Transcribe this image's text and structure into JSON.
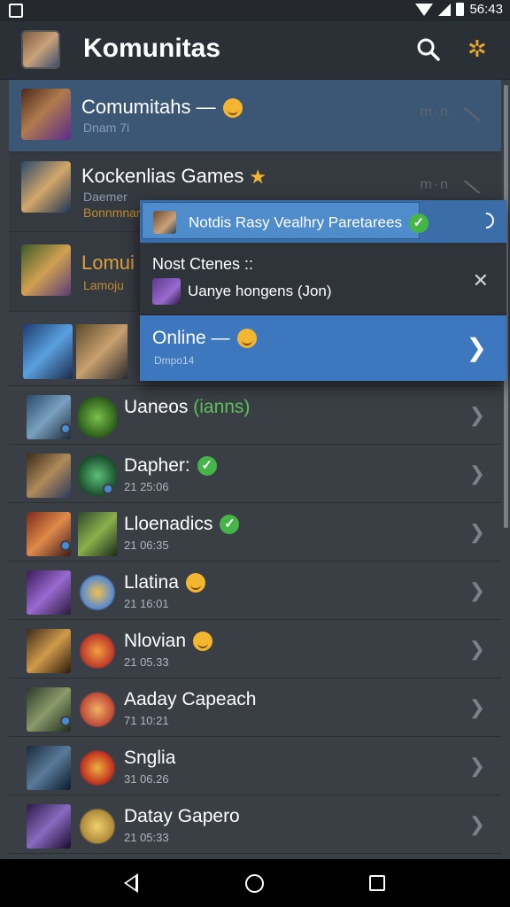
{
  "status_bar": {
    "time": "56:43"
  },
  "app_bar": {
    "title": "Komunitas"
  },
  "top_list": [
    {
      "name": "Comumitahs —",
      "sub": "Dnam 7i",
      "mute": "m·n"
    },
    {
      "name": "Kockenlias Games",
      "sub": "Daemer",
      "sub2": "Bonnmnar",
      "mute": "m·n"
    },
    {
      "name": "Lomui",
      "sub": "Lamoju"
    }
  ],
  "popup": {
    "banner_text": "Notdis Rasy Vealhry Paretarees",
    "menu1_title": "Nost Ctenes ::",
    "menu1_sub": "Uanye hongens (Jon)",
    "menu2_title": "Online —",
    "menu2_sub": "Dmpo14"
  },
  "rows": [
    {
      "name": "Uaneos",
      "tag": "(ianns)",
      "time": ""
    },
    {
      "name": "Dapher:",
      "time": "21 25:06"
    },
    {
      "name": "Lloenadics",
      "time": "21 06:35"
    },
    {
      "name": "Llatina",
      "time": "21 16:01"
    },
    {
      "name": "Nlovian",
      "time": "21 05.33"
    },
    {
      "name": "Aaday Capeach",
      "time": "71 10:21"
    },
    {
      "name": "Snglia",
      "time": "31 06.26"
    },
    {
      "name": "Datay Gapero",
      "time": "21 05:33"
    }
  ],
  "icons": {
    "statusbar": [
      "image-icon",
      "wifi-icon",
      "signal-icon",
      "battery-icon"
    ],
    "appbar": [
      "avatar",
      "search-icon",
      "star-icon"
    ],
    "navbar": [
      "back-icon",
      "home-icon",
      "recents-icon"
    ]
  },
  "colors": {
    "accent": "#3d78bf",
    "online_green": "#46b548",
    "badge": "#f2b630"
  }
}
